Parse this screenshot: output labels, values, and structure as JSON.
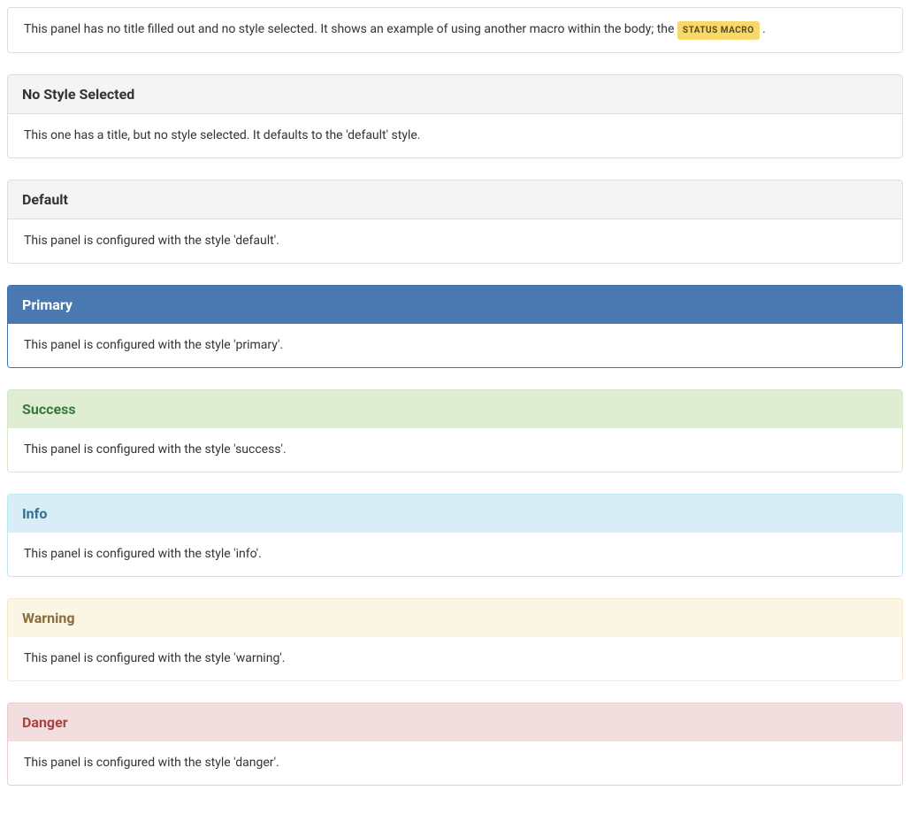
{
  "panels": [
    {
      "style": "none",
      "title": "",
      "body_before": "This panel has no title filled out and no style selected. It shows an example of using another macro within the body; the ",
      "status_label": "STATUS MACRO",
      "body_after": " ."
    },
    {
      "style": "default",
      "title": "No Style Selected",
      "body": "This one has a title, but no style selected. It defaults to the 'default' style."
    },
    {
      "style": "default",
      "title": "Default",
      "body": "This panel is configured with the style 'default'."
    },
    {
      "style": "primary",
      "title": "Primary",
      "body": "This panel is configured with the style 'primary'."
    },
    {
      "style": "success",
      "title": "Success",
      "body": "This panel is configured with the style 'success'."
    },
    {
      "style": "info",
      "title": "Info",
      "body": "This panel is configured with the style 'info'."
    },
    {
      "style": "warning",
      "title": "Warning",
      "body": "This panel is configured with the style 'warning'."
    },
    {
      "style": "danger",
      "title": "Danger",
      "body": "This panel is configured with the style 'danger'."
    }
  ]
}
